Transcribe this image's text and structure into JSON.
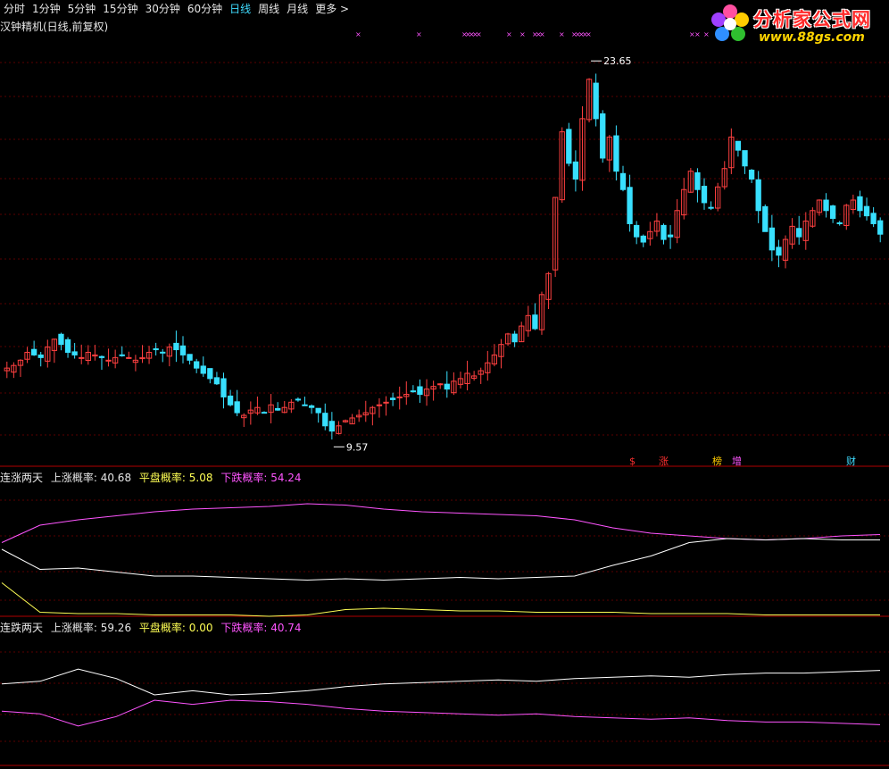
{
  "toolbar": {
    "tabs": [
      {
        "label": "分时",
        "active": false
      },
      {
        "label": "1分钟",
        "active": false
      },
      {
        "label": "5分钟",
        "active": false
      },
      {
        "label": "15分钟",
        "active": false
      },
      {
        "label": "30分钟",
        "active": false
      },
      {
        "label": "60分钟",
        "active": false
      },
      {
        "label": "日线",
        "active": true
      },
      {
        "label": "周线",
        "active": false
      },
      {
        "label": "月线",
        "active": false
      },
      {
        "label": "更多 >",
        "active": false
      }
    ]
  },
  "subtitle": "汉钟精机(日线,前复权)",
  "logo": {
    "brand": "分析家公式网",
    "url": "www.88gs.com"
  },
  "colors": {
    "up": "#ff4040",
    "down": "#38e0ff",
    "grid": "#5a0000",
    "white": "#ffffff",
    "yellow": "#ffff55",
    "magenta": "#ff55ff",
    "sep": "#b00000"
  },
  "event_markers": [
    "$",
    "涨",
    "榜",
    "增",
    "财"
  ],
  "chart_data": [
    {
      "type": "candlestick",
      "price_range": [
        8.5,
        25.0
      ],
      "annotations": {
        "high": "23.65",
        "low": "9.57"
      },
      "closes": [
        12.0,
        12.1,
        12.3,
        12.6,
        12.5,
        12.4,
        12.8,
        13.1,
        12.9,
        12.6,
        12.5,
        12.4,
        12.6,
        12.5,
        12.4,
        12.3,
        12.4,
        12.5,
        12.4,
        12.3,
        12.4,
        12.6,
        12.7,
        12.6,
        12.8,
        12.7,
        12.5,
        12.3,
        12.0,
        11.8,
        11.6,
        11.4,
        10.9,
        10.6,
        10.3,
        10.2,
        10.4,
        10.5,
        10.3,
        10.6,
        10.4,
        10.5,
        10.7,
        10.8,
        10.6,
        10.5,
        10.3,
        9.8,
        9.6,
        9.8,
        10.0,
        10.1,
        10.2,
        10.3,
        10.5,
        10.6,
        10.7,
        10.8,
        10.9,
        11.0,
        11.1,
        11.0,
        11.2,
        11.3,
        11.4,
        11.2,
        11.5,
        11.6,
        11.8,
        11.7,
        11.9,
        12.2,
        12.5,
        12.9,
        13.3,
        13.0,
        13.6,
        14.0,
        13.5,
        14.8,
        15.6,
        18.5,
        21.0,
        19.8,
        19.2,
        21.5,
        23.0,
        21.5,
        20.0,
        20.8,
        19.5,
        18.8,
        17.5,
        17.0,
        16.8,
        17.2,
        17.6,
        16.9,
        17.0,
        18.0,
        18.8,
        19.5,
        18.8,
        18.3,
        18.1,
        18.9,
        19.6,
        20.8,
        20.3,
        19.7,
        19.2,
        18.0,
        17.2,
        16.5,
        16.3,
        16.9,
        17.4,
        17.0,
        17.6,
        18.0,
        18.4,
        18.0,
        17.7,
        17.5,
        18.2,
        18.4,
        18.0,
        17.8,
        17.5,
        17.1
      ],
      "prob_up_panel": {
        "title": "连涨两天",
        "labels": [
          "上涨概率:",
          "平盘概率:",
          "下跌概率:"
        ],
        "values": [
          "40.68",
          "5.08",
          "54.24"
        ],
        "range": [
          0,
          100
        ],
        "series_white": [
          50,
          35,
          36,
          33,
          30,
          30,
          29,
          28,
          27,
          28,
          27,
          28,
          29,
          28,
          29,
          30,
          38,
          45,
          55,
          58,
          57,
          58,
          57,
          57
        ],
        "series_yellow": [
          25,
          3,
          2,
          2,
          1,
          1,
          1,
          0,
          1,
          5,
          6,
          5,
          4,
          4,
          3,
          3,
          3,
          2,
          2,
          2,
          1,
          1,
          1,
          1
        ],
        "series_magenta": [
          55,
          68,
          72,
          75,
          78,
          80,
          81,
          82,
          84,
          83,
          80,
          78,
          77,
          76,
          75,
          72,
          66,
          62,
          60,
          58,
          57,
          58,
          60,
          61
        ]
      },
      "prob_down_panel": {
        "title": "连跌两天",
        "labels": [
          "上涨概率:",
          "平盘概率:",
          "下跌概率:"
        ],
        "values": [
          "59.26",
          "0.00",
          "40.74"
        ],
        "range": [
          0,
          100
        ],
        "series_white": [
          60,
          62,
          71,
          64,
          52,
          55,
          52,
          53,
          55,
          58,
          60,
          61,
          62,
          63,
          62,
          64,
          65,
          66,
          65,
          67,
          68,
          68,
          69,
          70
        ],
        "series_magenta": [
          40,
          38,
          29,
          36,
          48,
          45,
          48,
          47,
          45,
          42,
          40,
          39,
          38,
          37,
          38,
          36,
          35,
          34,
          35,
          33,
          32,
          32,
          31,
          30
        ]
      }
    }
  ]
}
